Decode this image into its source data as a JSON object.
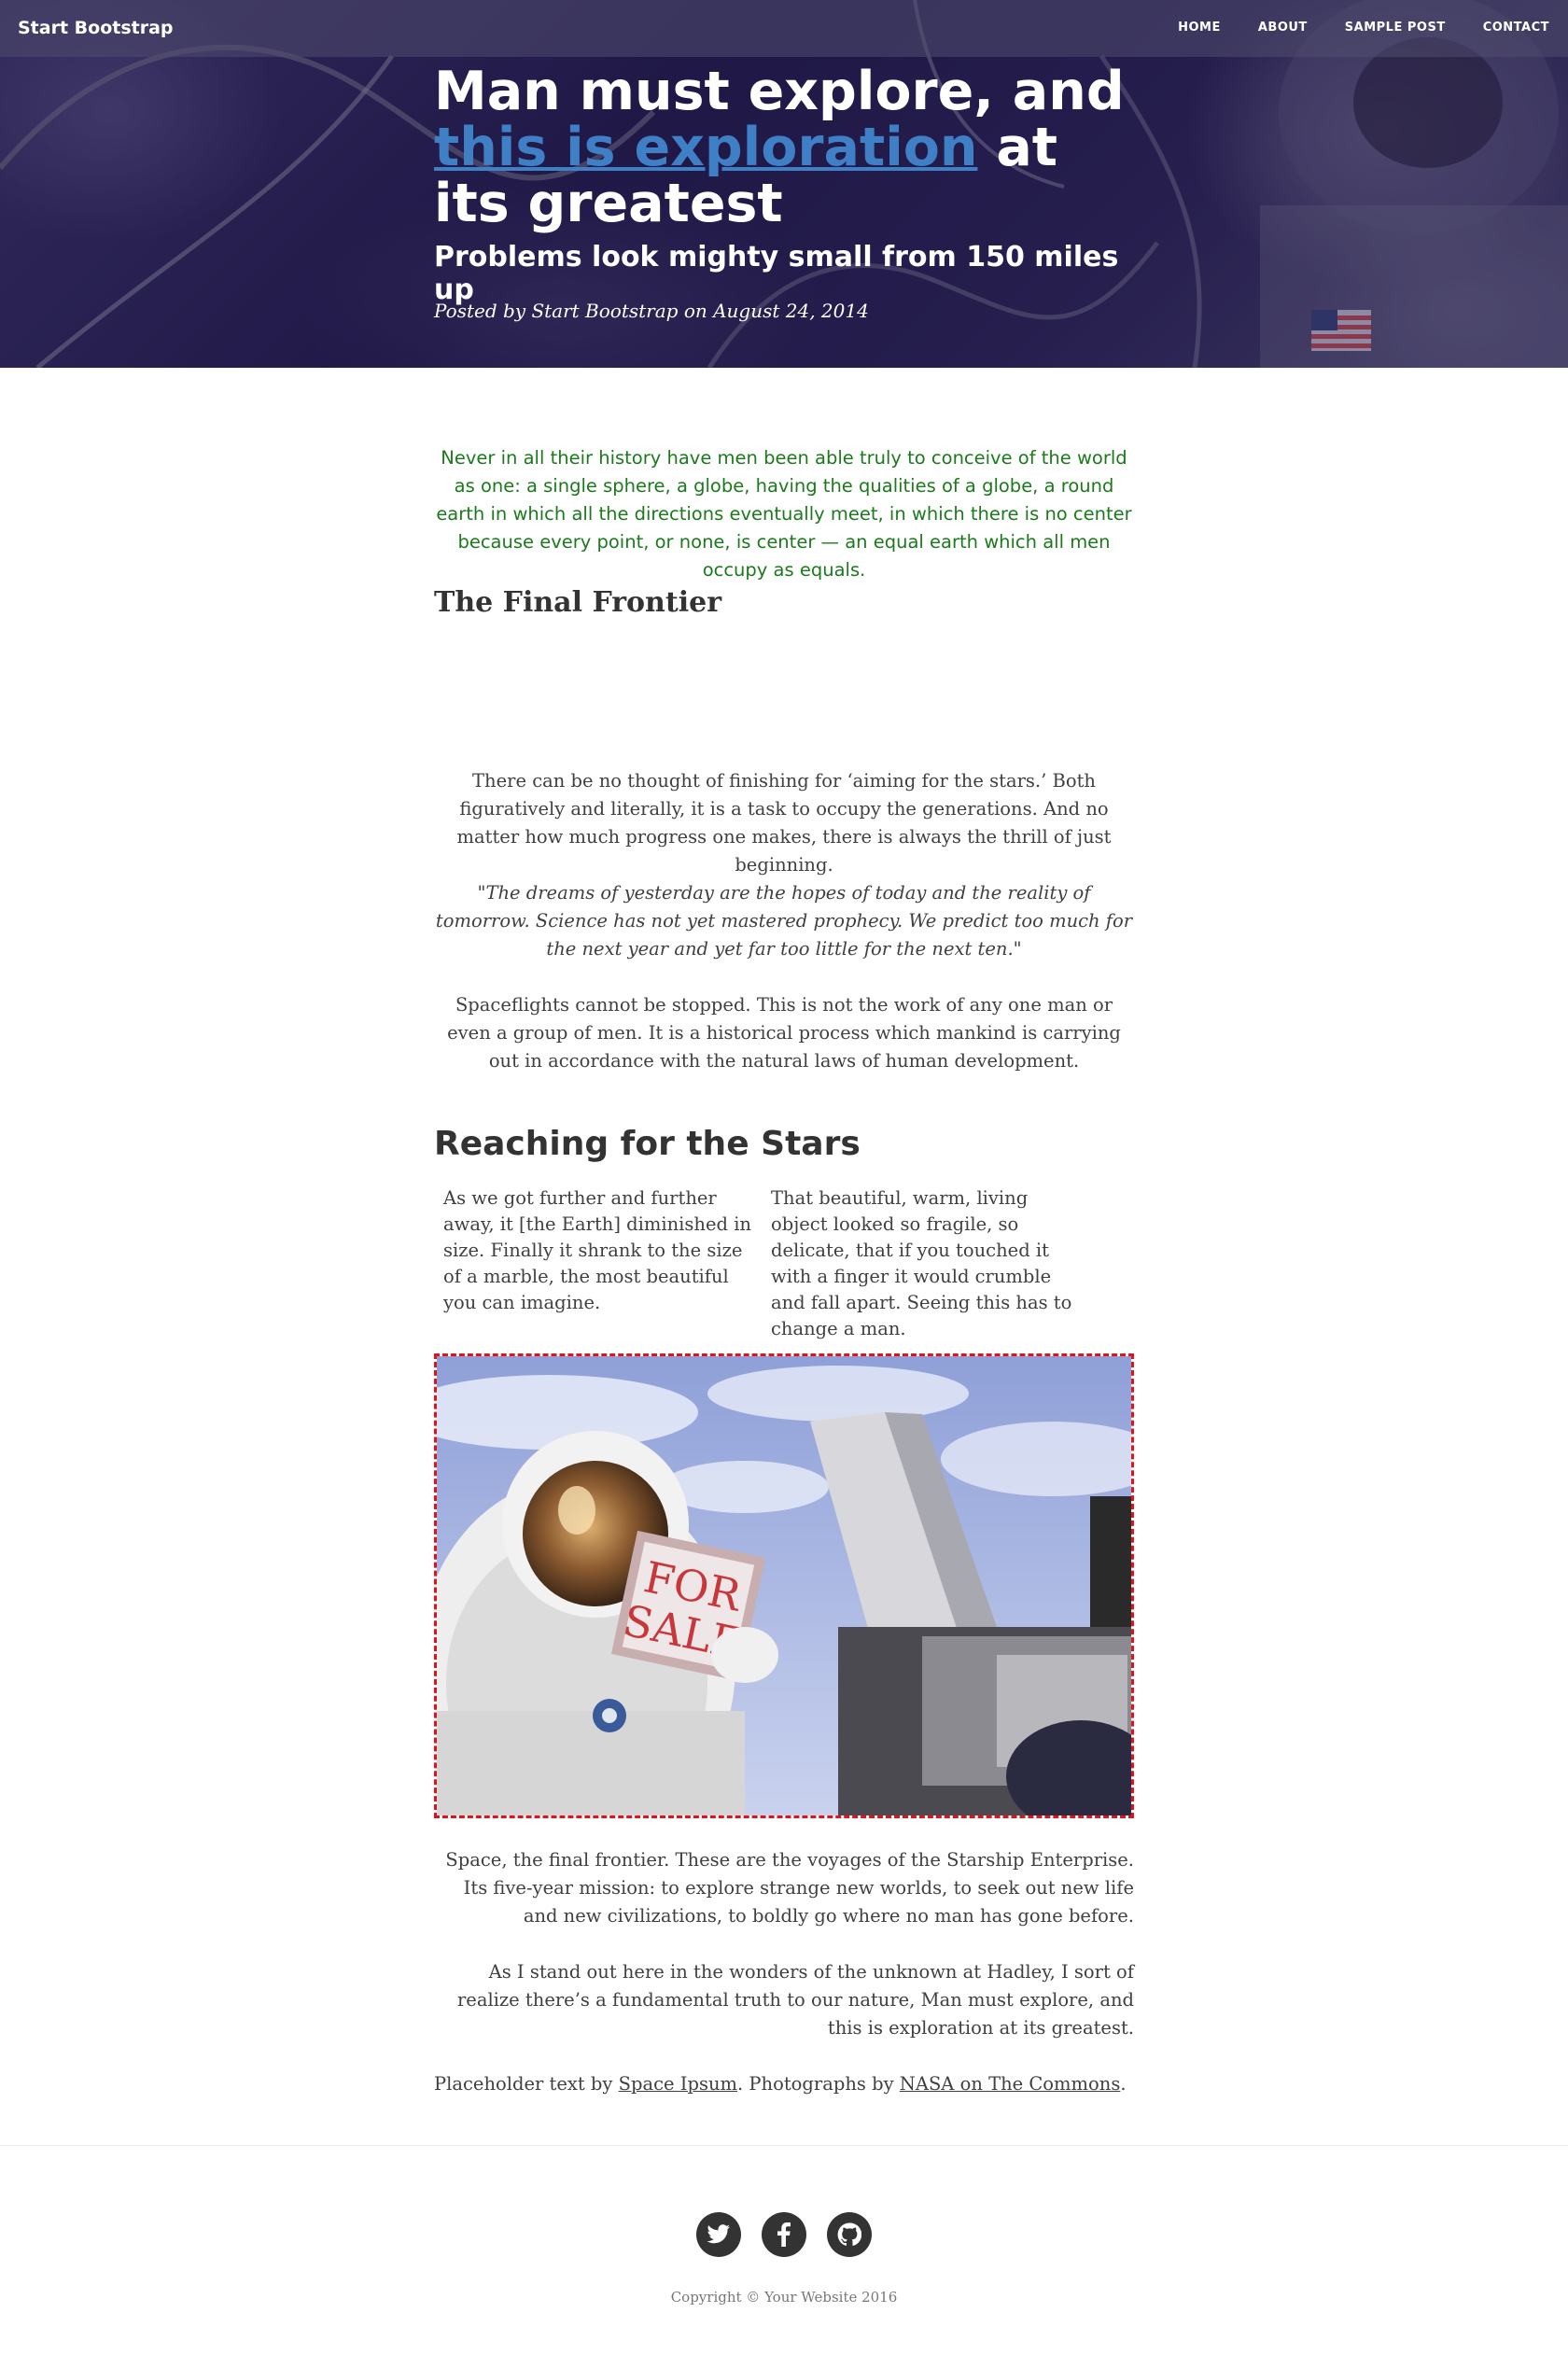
{
  "nav": {
    "brand": "Start Bootstrap",
    "links": [
      "HOME",
      "ABOUT",
      "SAMPLE POST",
      "CONTACT"
    ]
  },
  "hero": {
    "title_part1": "Man must explore, and ",
    "title_link": "this is exploration",
    "title_part2": " at its greatest",
    "subtitle": "Problems look mighty small from 150 miles up",
    "meta": "Posted by Start Bootstrap on August 24, 2014"
  },
  "article": {
    "green_quote": "Never in all their history have men been able truly to conceive of the world as one: a single sphere, a globe, having the qualities of a globe, a round earth in which all the directions eventually meet, in which there is no center because every point, or none, is center — an equal earth which all men occupy as equals.",
    "heading_final": "The Final Frontier",
    "para1": "There can be no thought of finishing for ‘aiming for the stars.’ Both figuratively and literally, it is a task to occupy the generations. And no matter how much progress one makes, there is always the thrill of just beginning.",
    "para2": "\"The dreams of yesterday are the hopes of today and the reality of tomorrow. Science has not yet mastered prophecy. We predict too much for the next year and yet far too little for the next ten.\"",
    "para3": "Spaceflights cannot be stopped. This is not the work of any one man or even a group of men. It is a historical process which mankind is carrying out in accordance with the natural laws of human development.",
    "heading_reach": "Reaching for the Stars",
    "col_left": "As we got further and further away, it [the Earth] diminished in size. Finally it shrank to the size of a marble, the most beautiful you can imagine.",
    "col_right": "That beautiful, warm, living object looked so fragile, so delicate, that if you touched it with a finger it would crumble and fall apart. Seeing this has to change a man.",
    "photo_sign": [
      "FOR",
      "SALE"
    ],
    "para4": "Space, the final frontier. These are the voyages of the Starship Enterprise. Its five-year mission: to explore strange new worlds, to seek out new life and new civilizations, to boldly go where no man has gone before.",
    "para5": "As I stand out here in the wonders of the unknown at Hadley, I sort of realize there’s a fundamental truth to our nature, Man must explore, and this is exploration at its greatest.",
    "credits_prefix": "Placeholder text by ",
    "credits_link1": "Space Ipsum",
    "credits_mid": ". Photographs by ",
    "credits_link2": "NASA on The Commons",
    "credits_suffix": "."
  },
  "footer": {
    "social_icons": [
      "twitter-icon",
      "facebook-icon",
      "github-icon"
    ],
    "copyright": "Copyright © Your Website 2016"
  },
  "colors": {
    "hero_link": "#3f7fc6",
    "green_quote": "#1b7a1b",
    "photo_border": "#e0121b"
  }
}
